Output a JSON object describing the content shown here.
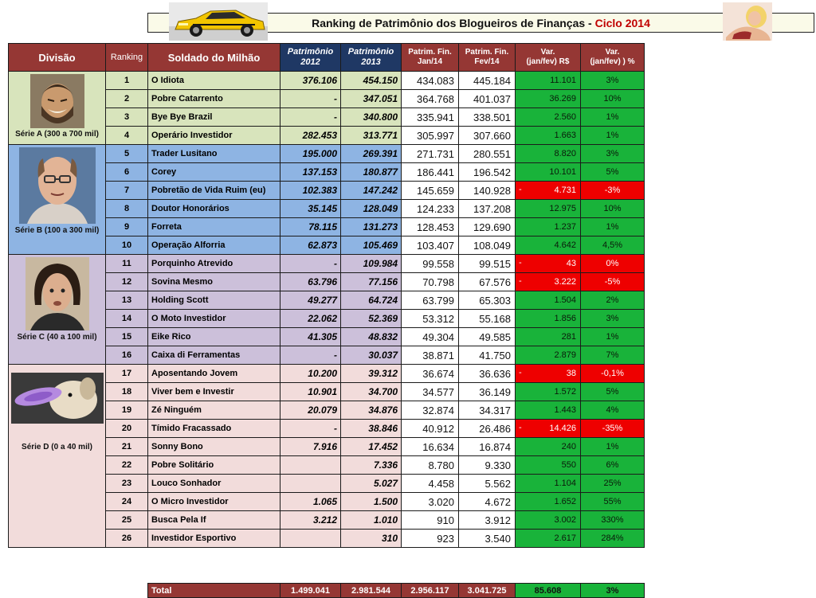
{
  "header": {
    "title_main": "Ranking de Patrimônio dos Blogueiros de Finanças - ",
    "title_accent": "Ciclo 2014"
  },
  "columns": {
    "divisao": "Divisão",
    "ranking": "Ranking",
    "soldado": "Soldado do Milhão",
    "p2012_line1": "Patrimônio",
    "p2012_line2": "2012",
    "p2013_line1": "Patrimônio",
    "p2013_line2": "2013",
    "jan_line1": "Patrim. Fin.",
    "jan_line2": "Jan/14",
    "fev_line1": "Patrim. Fin.",
    "fev_line2": "Fev/14",
    "var_line1": "Var.",
    "var_line2": "(jan/fev) R$",
    "pct_line1": "Var.",
    "pct_line2": "(jan/fev) ) %"
  },
  "divisions": [
    {
      "label": "Série A (300 a 700 mil)",
      "color": "#d8e4bc"
    },
    {
      "label": "Série B (100 a 300 mil)",
      "color": "#8eb4e3"
    },
    {
      "label": "Série C (40 a 100 mil)",
      "color": "#ccc0da"
    },
    {
      "label": "Série D (0 a 40 mil)",
      "color": "#f2dcdb"
    }
  ],
  "rows": [
    {
      "rank": "1",
      "name": "O Idiota",
      "p12": "376.106",
      "p13": "454.150",
      "jan": "434.083",
      "fev": "445.184",
      "var": "11.101",
      "pct": "3%",
      "neg": false
    },
    {
      "rank": "2",
      "name": "Pobre Catarrento",
      "p12": "-",
      "p13": "347.051",
      "jan": "364.768",
      "fev": "401.037",
      "var": "36.269",
      "pct": "10%",
      "neg": false
    },
    {
      "rank": "3",
      "name": "Bye Bye Brazil",
      "p12": "-",
      "p13": "340.800",
      "jan": "335.941",
      "fev": "338.501",
      "var": "2.560",
      "pct": "1%",
      "neg": false
    },
    {
      "rank": "4",
      "name": "Operário Investidor",
      "p12": "282.453",
      "p13": "313.771",
      "jan": "305.997",
      "fev": "307.660",
      "var": "1.663",
      "pct": "1%",
      "neg": false
    },
    {
      "rank": "5",
      "name": "Trader Lusitano",
      "p12": "195.000",
      "p13": "269.391",
      "jan": "271.731",
      "fev": "280.551",
      "var": "8.820",
      "pct": "3%",
      "neg": false
    },
    {
      "rank": "6",
      "name": "Corey",
      "p12": "137.153",
      "p13": "180.877",
      "jan": "186.441",
      "fev": "196.542",
      "var": "10.101",
      "pct": "5%",
      "neg": false
    },
    {
      "rank": "7",
      "name": "Pobretão de Vida Ruim (eu)",
      "p12": "102.383",
      "p13": "147.242",
      "jan": "145.659",
      "fev": "140.928",
      "var": "4.731",
      "pct": "-3%",
      "neg": true
    },
    {
      "rank": "8",
      "name": "Doutor Honorários",
      "p12": "35.145",
      "p13": "128.049",
      "jan": "124.233",
      "fev": "137.208",
      "var": "12.975",
      "pct": "10%",
      "neg": false
    },
    {
      "rank": "9",
      "name": "Forreta",
      "p12": "78.115",
      "p13": "131.273",
      "jan": "128.453",
      "fev": "129.690",
      "var": "1.237",
      "pct": "1%",
      "neg": false
    },
    {
      "rank": "10",
      "name": "Operação Alforria",
      "p12": "62.873",
      "p13": "105.469",
      "jan": "103.407",
      "fev": "108.049",
      "var": "4.642",
      "pct": "4,5%",
      "neg": false
    },
    {
      "rank": "11",
      "name": "Porquinho Atrevido",
      "p12": "-",
      "p13": "109.984",
      "jan": "99.558",
      "fev": "99.515",
      "var": "43",
      "pct": "0%",
      "neg": true
    },
    {
      "rank": "12",
      "name": "Sovina Mesmo",
      "p12": "63.796",
      "p13": "77.156",
      "jan": "70.798",
      "fev": "67.576",
      "var": "3.222",
      "pct": "-5%",
      "neg": true
    },
    {
      "rank": "13",
      "name": "Holding Scott",
      "p12": "49.277",
      "p13": "64.724",
      "jan": "63.799",
      "fev": "65.303",
      "var": "1.504",
      "pct": "2%",
      "neg": false
    },
    {
      "rank": "14",
      "name": "O Moto Investidor",
      "p12": "22.062",
      "p13": "52.369",
      "jan": "53.312",
      "fev": "55.168",
      "var": "1.856",
      "pct": "3%",
      "neg": false
    },
    {
      "rank": "15",
      "name": "Eike Rico",
      "p12": "41.305",
      "p13": "48.832",
      "jan": "49.304",
      "fev": "49.585",
      "var": "281",
      "pct": "1%",
      "neg": false
    },
    {
      "rank": "16",
      "name": "Caixa di Ferramentas",
      "p12": "-",
      "p13": "30.037",
      "jan": "38.871",
      "fev": "41.750",
      "var": "2.879",
      "pct": "7%",
      "neg": false
    },
    {
      "rank": "17",
      "name": "Aposentando Jovem",
      "p12": "10.200",
      "p13": "39.312",
      "jan": "36.674",
      "fev": "36.636",
      "var": "38",
      "pct": "-0,1%",
      "neg": true
    },
    {
      "rank": "18",
      "name": "Viver bem e Investir",
      "p12": "10.901",
      "p13": "34.700",
      "jan": "34.577",
      "fev": "36.149",
      "var": "1.572",
      "pct": "5%",
      "neg": false
    },
    {
      "rank": "19",
      "name": "Zé Ninguém",
      "p12": "20.079",
      "p13": "34.876",
      "jan": "32.874",
      "fev": "34.317",
      "var": "1.443",
      "pct": "4%",
      "neg": false
    },
    {
      "rank": "20",
      "name": "Tímido Fracassado",
      "p12": "-",
      "p13": "38.846",
      "jan": "40.912",
      "fev": "26.486",
      "var": "14.426",
      "pct": "-35%",
      "neg": true
    },
    {
      "rank": "21",
      "name": "Sonny Bono",
      "p12": "7.916",
      "p13": "17.452",
      "jan": "16.634",
      "fev": "16.874",
      "var": "240",
      "pct": "1%",
      "neg": false
    },
    {
      "rank": "22",
      "name": "Pobre Solitário",
      "p12": "",
      "p13": "7.336",
      "jan": "8.780",
      "fev": "9.330",
      "var": "550",
      "pct": "6%",
      "neg": false
    },
    {
      "rank": "23",
      "name": "Louco Sonhador",
      "p12": "",
      "p13": "5.027",
      "jan": "4.458",
      "fev": "5.562",
      "var": "1.104",
      "pct": "25%",
      "neg": false
    },
    {
      "rank": "24",
      "name": "O Micro Investidor",
      "p12": "1.065",
      "p13": "1.500",
      "jan": "3.020",
      "fev": "4.672",
      "var": "1.652",
      "pct": "55%",
      "neg": false
    },
    {
      "rank": "25",
      "name": "Busca Pela If",
      "p12": "3.212",
      "p13": "1.010",
      "jan": "910",
      "fev": "3.912",
      "var": "3.002",
      "pct": "330%",
      "neg": false
    },
    {
      "rank": "26",
      "name": "Investidor Esportivo",
      "p12": "",
      "p13": "310",
      "jan": "923",
      "fev": "3.540",
      "var": "2.617",
      "pct": "284%",
      "neg": false
    }
  ],
  "total": {
    "label": "Total",
    "p12": "1.499.041",
    "p13": "2.981.544",
    "jan": "2.956.117",
    "fev": "3.041.725",
    "var": "85.608",
    "pct": "3%"
  },
  "negative_marker": "-",
  "colors": {
    "header_red": "#953734",
    "header_navy": "#1f3864",
    "positive_green": "#19b33a",
    "negative_red": "#ee0000"
  }
}
